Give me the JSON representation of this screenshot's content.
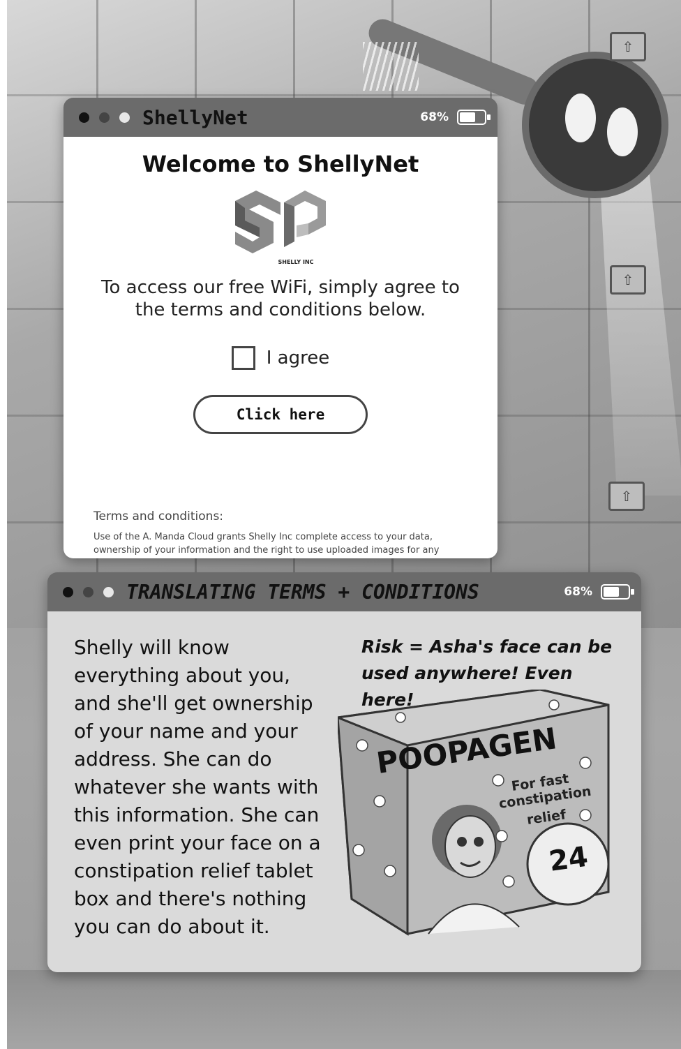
{
  "login_window": {
    "title": "ShellyNet",
    "battery": "68%",
    "battery_level": 0.68,
    "welcome": "Welcome to ShellyNet",
    "logo_text": "SHELLY INC",
    "intro_line1": "To access our free WiFi, simply agree to",
    "intro_line2": "the terms and conditions below.",
    "agree_label": "I agree",
    "button_label": "Click here",
    "terms_heading": "Terms and conditions:",
    "terms_body": "Use of the A. Manda Cloud grants Shelly Inc complete access to your data, ownership of your information and the right to use uploaded images for any purpose."
  },
  "translation_window": {
    "title": "TRANSLATING TERMS + CONDITIONS",
    "battery": "68%",
    "battery_level": 0.68,
    "paragraph": "Shelly will know everything about you, and she'll get ownership of your name and your address. She can do whatever she wants with this information. She can even print your face on a constipation relief tablet box and there's nothing you can do about it.",
    "risk": "Risk = Asha's face can be used anywhere! Even here!",
    "product": {
      "name": "POOPAGEN",
      "tagline_1": "For fast",
      "tagline_2": "constipation",
      "tagline_3": "relief",
      "count": "24"
    }
  },
  "colors": {
    "titlebar": "#6b6b6b",
    "panel_white": "#ffffff",
    "panel_grey": "#dadada"
  }
}
